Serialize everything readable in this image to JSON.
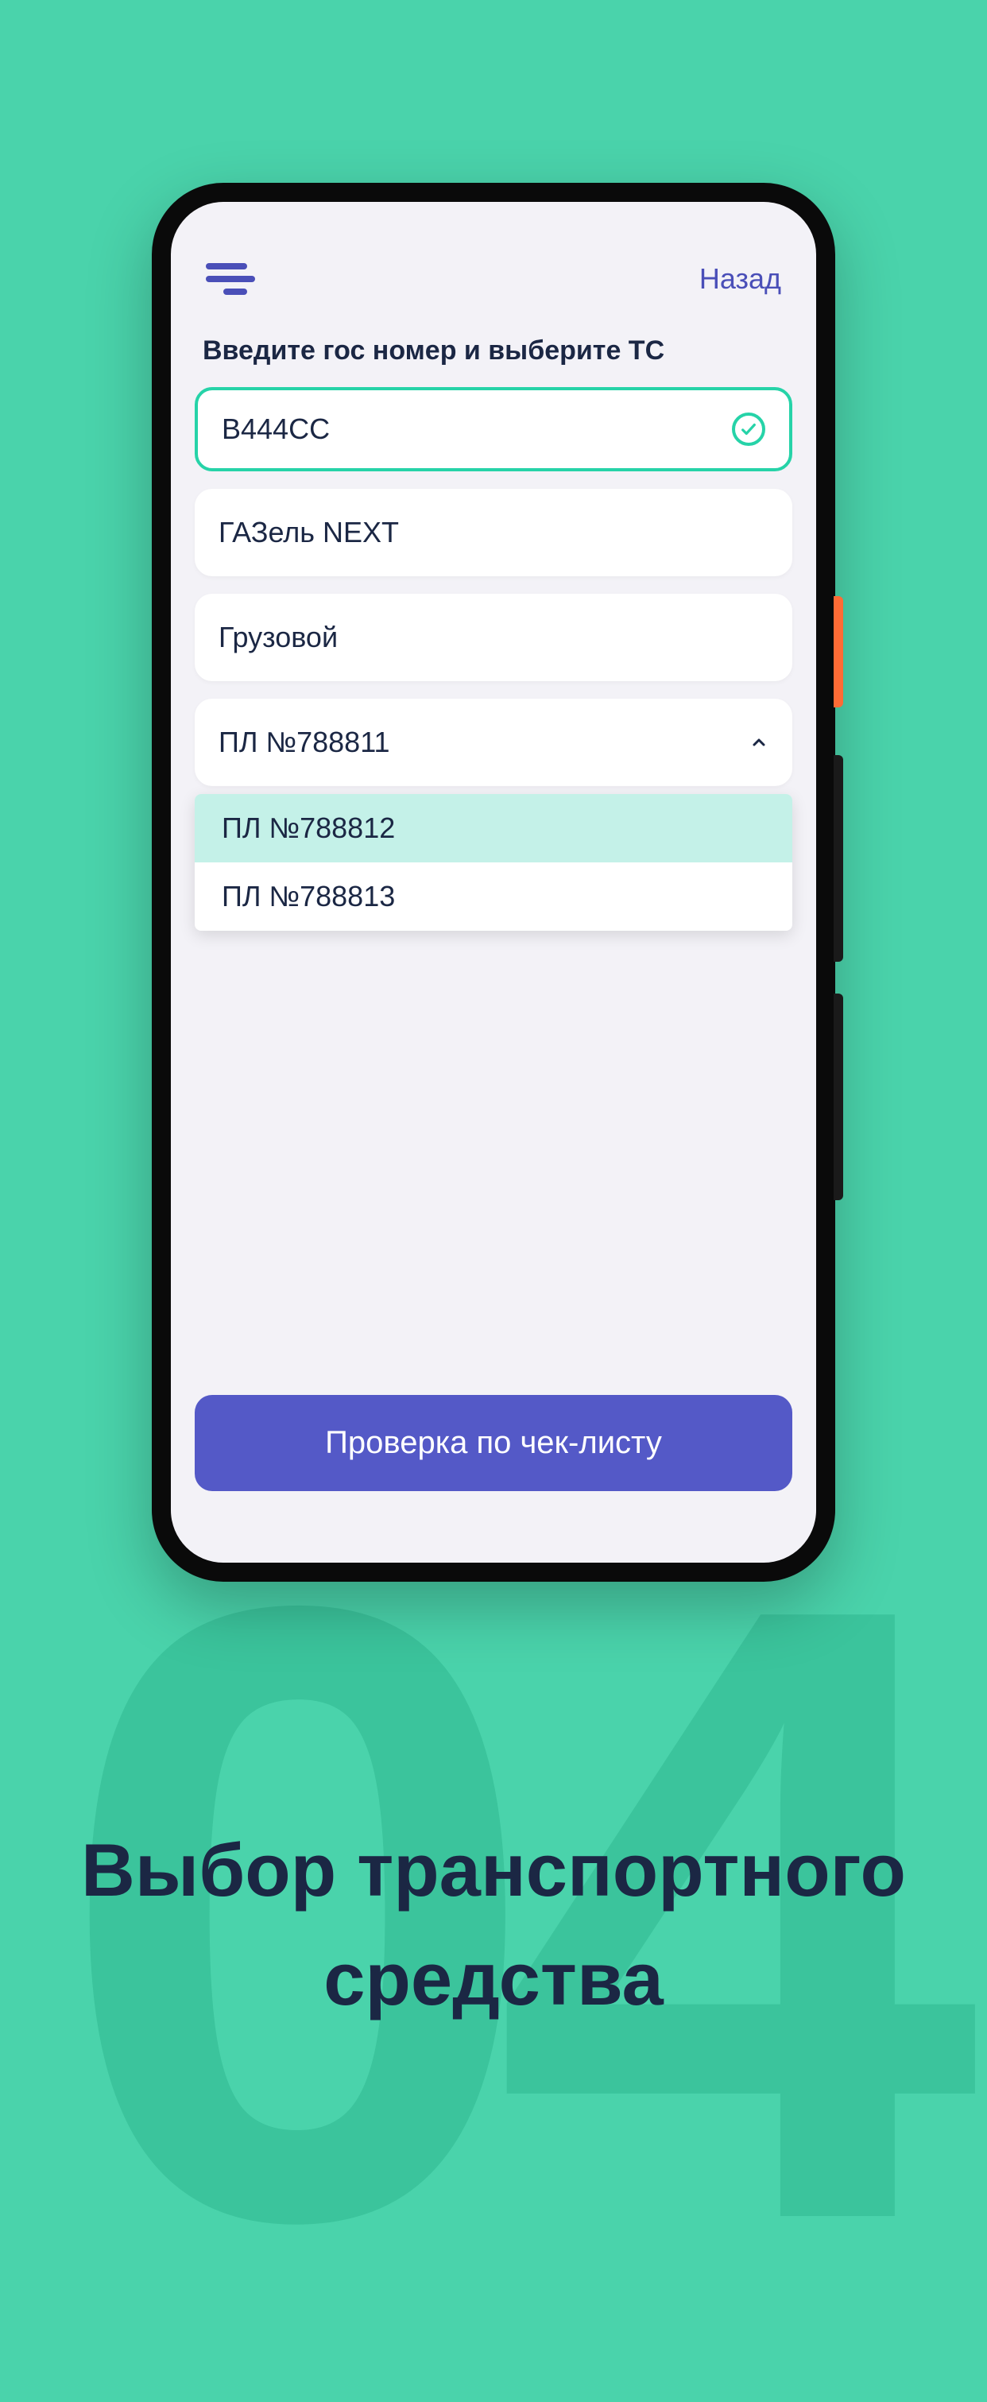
{
  "header": {
    "back_label": "Назад"
  },
  "form": {
    "title": "Введите гос номер и выберите ТС",
    "plate_value": "В444СС",
    "vehicle_model": "ГАЗель NEXT",
    "vehicle_type": "Грузовой",
    "dropdown_selected": "ПЛ №788811",
    "dropdown_options": [
      "ПЛ №788812",
      "ПЛ №788813"
    ],
    "submit_label": "Проверка по чек-листу"
  },
  "promo": {
    "page_number": "04",
    "title": "Выбор транспортного средства"
  }
}
